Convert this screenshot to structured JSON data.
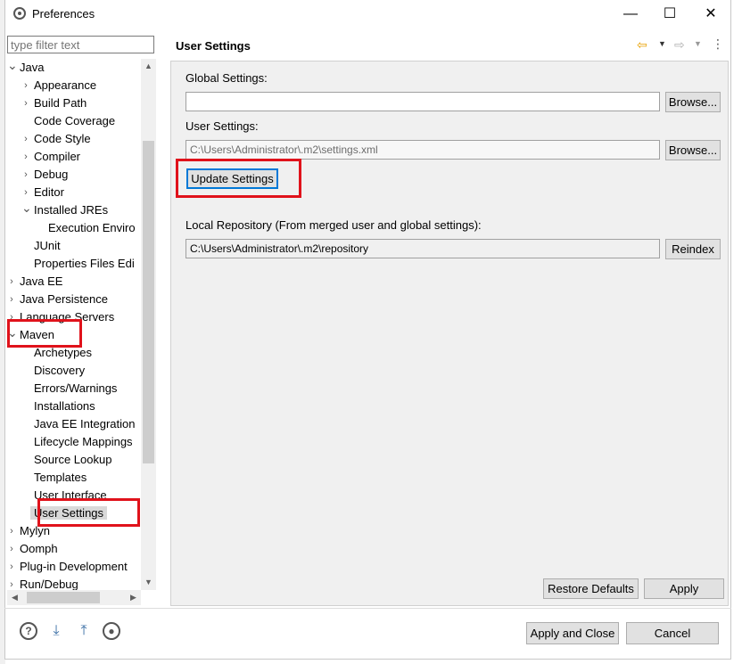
{
  "window": {
    "title": "Preferences",
    "minimize": "—",
    "maximize": "☐",
    "close": "✕"
  },
  "filter": {
    "placeholder": "type filter text",
    "value": ""
  },
  "tree": {
    "items": [
      {
        "label": "Java",
        "level": 0,
        "expander": "open"
      },
      {
        "label": "Appearance",
        "level": 1,
        "expander": "closed"
      },
      {
        "label": "Build Path",
        "level": 1,
        "expander": "closed"
      },
      {
        "label": "Code Coverage",
        "level": 1,
        "expander": "none"
      },
      {
        "label": "Code Style",
        "level": 1,
        "expander": "closed"
      },
      {
        "label": "Compiler",
        "level": 1,
        "expander": "closed"
      },
      {
        "label": "Debug",
        "level": 1,
        "expander": "closed"
      },
      {
        "label": "Editor",
        "level": 1,
        "expander": "closed"
      },
      {
        "label": "Installed JREs",
        "level": 1,
        "expander": "open"
      },
      {
        "label": "Execution Enviro",
        "level": 2,
        "expander": "none"
      },
      {
        "label": "JUnit",
        "level": 1,
        "expander": "none"
      },
      {
        "label": "Properties Files Edi",
        "level": 1,
        "expander": "none"
      },
      {
        "label": "Java EE",
        "level": 0,
        "expander": "closed"
      },
      {
        "label": "Java Persistence",
        "level": 0,
        "expander": "closed"
      },
      {
        "label": "Language Servers",
        "level": 0,
        "expander": "closed"
      },
      {
        "label": "Maven",
        "level": 0,
        "expander": "open"
      },
      {
        "label": "Archetypes",
        "level": 1,
        "expander": "none"
      },
      {
        "label": "Discovery",
        "level": 1,
        "expander": "none"
      },
      {
        "label": "Errors/Warnings",
        "level": 1,
        "expander": "none"
      },
      {
        "label": "Installations",
        "level": 1,
        "expander": "none"
      },
      {
        "label": "Java EE Integration",
        "level": 1,
        "expander": "none"
      },
      {
        "label": "Lifecycle Mappings",
        "level": 1,
        "expander": "none"
      },
      {
        "label": "Source Lookup",
        "level": 1,
        "expander": "none"
      },
      {
        "label": "Templates",
        "level": 1,
        "expander": "none"
      },
      {
        "label": "User Interface",
        "level": 1,
        "expander": "none"
      },
      {
        "label": "User Settings",
        "level": 1,
        "expander": "none",
        "selected": true
      },
      {
        "label": "Mylyn",
        "level": 0,
        "expander": "closed"
      },
      {
        "label": "Oomph",
        "level": 0,
        "expander": "closed"
      },
      {
        "label": "Plug-in Development",
        "level": 0,
        "expander": "closed"
      },
      {
        "label": "Run/Debug",
        "level": 0,
        "expander": "closed"
      }
    ]
  },
  "page": {
    "title": "User Settings",
    "global_label": "Global Settings:",
    "global_value": "",
    "browse1": "Browse...",
    "user_label": "User Settings:",
    "user_value": "C:\\Users\\Administrator\\.m2\\settings.xml",
    "browse2": "Browse...",
    "update": "Update Settings",
    "local_label": "Local Repository (From merged user and global settings):",
    "local_value": "C:\\Users\\Administrator\\.m2\\repository",
    "reindex": "Reindex",
    "restore": "Restore Defaults",
    "apply": "Apply"
  },
  "footer": {
    "apply_close": "Apply and Close",
    "cancel": "Cancel"
  },
  "colors": {
    "highlight": "#e0121b",
    "nav_arrow": "#e8a000",
    "selection": "#d9d9d9"
  }
}
